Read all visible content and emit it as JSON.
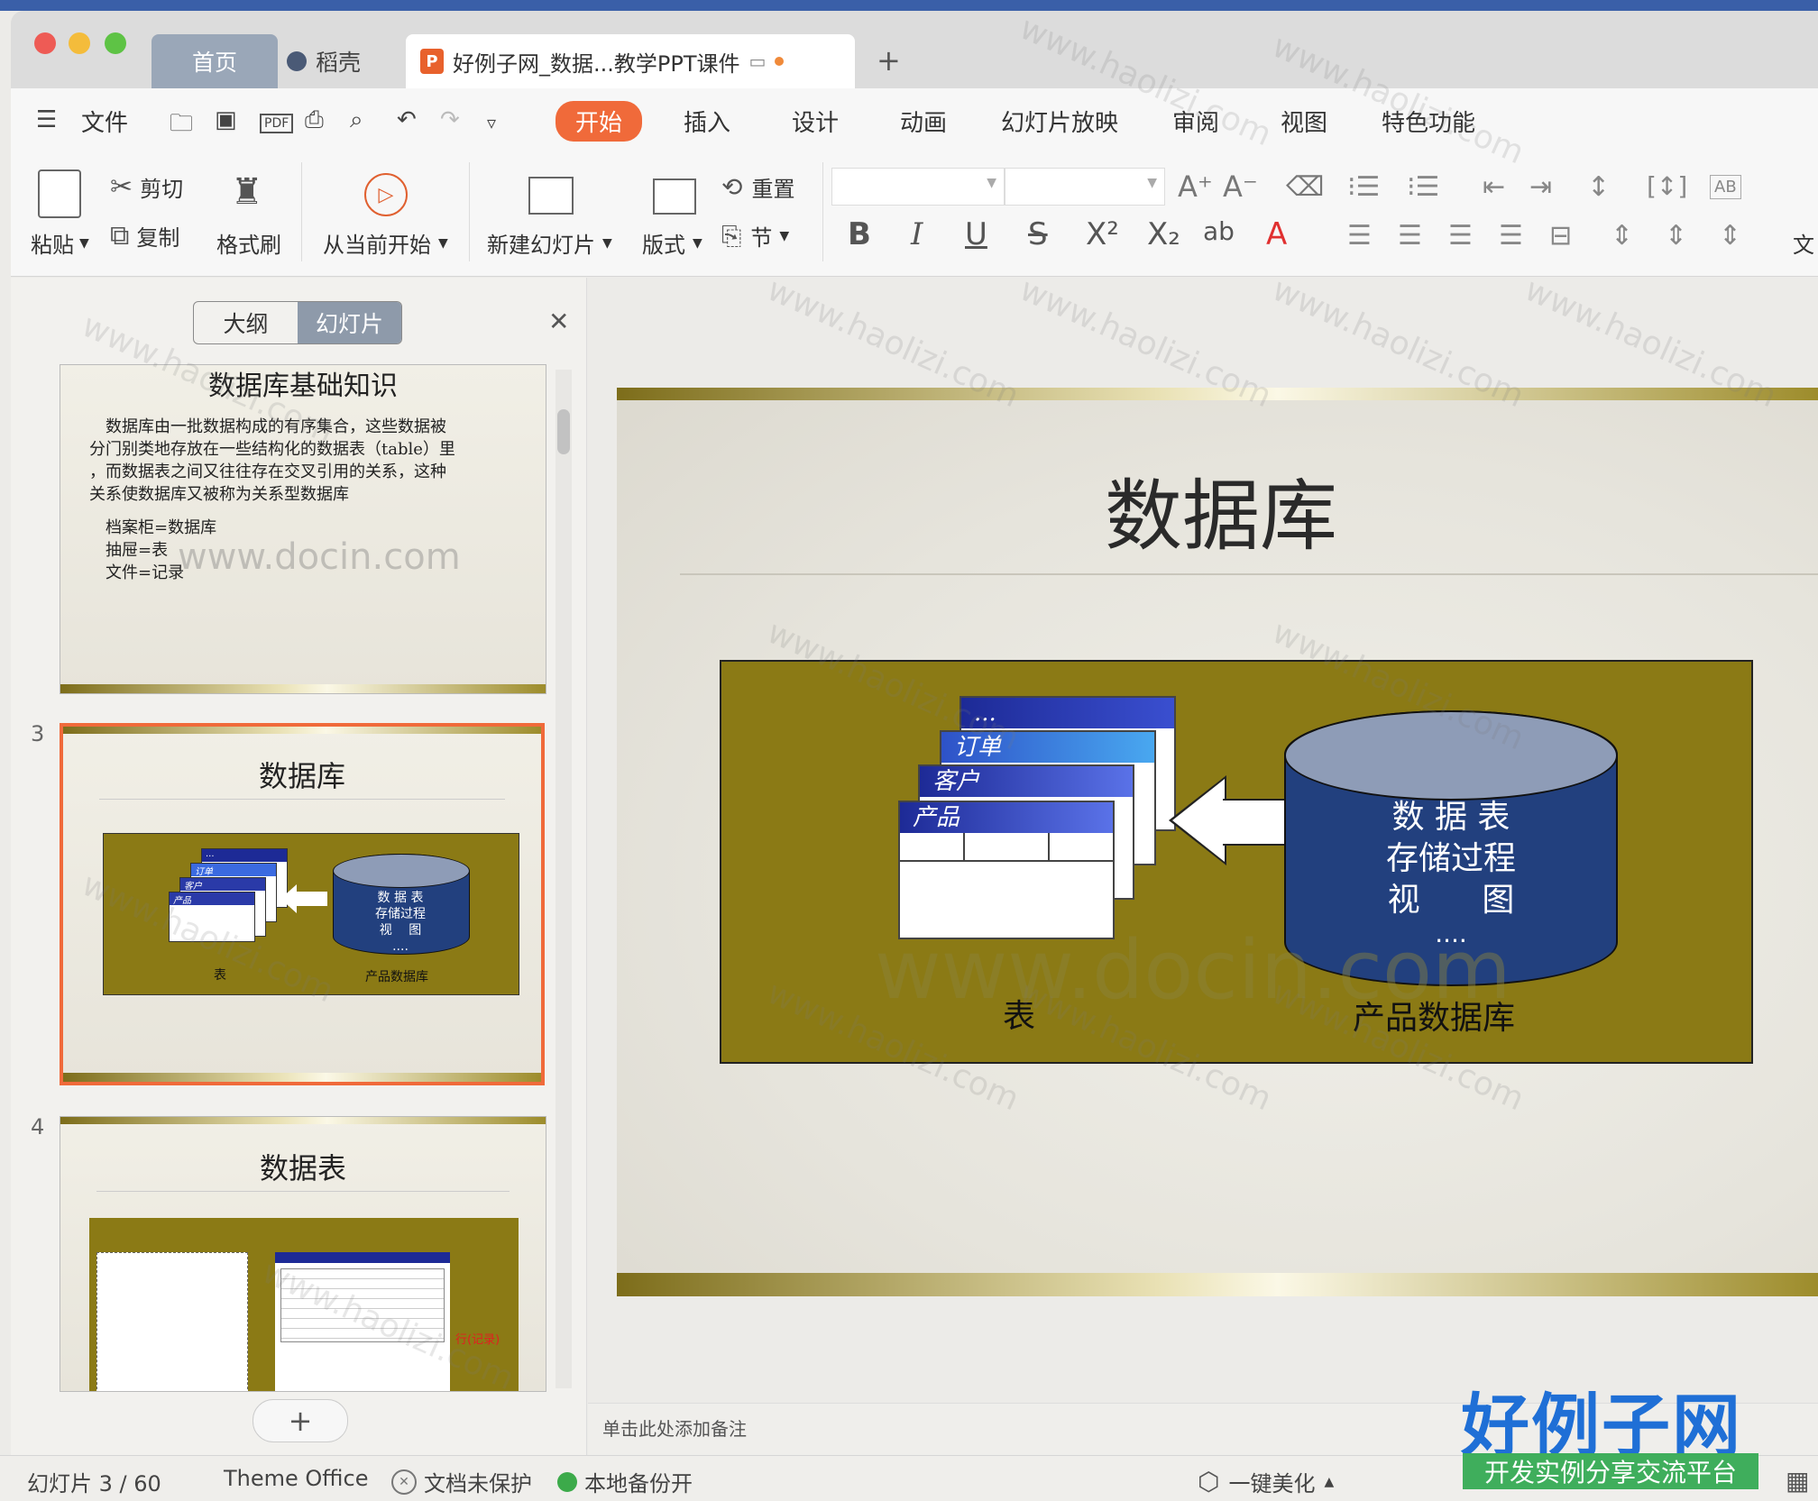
{
  "tabs": {
    "home": "首页",
    "daoke": "稻壳",
    "doc_title": "好例子网_数据...教学PPT课件"
  },
  "menu": {
    "file": "文件",
    "tabs": [
      "开始",
      "插入",
      "设计",
      "动画",
      "幻灯片放映",
      "审阅",
      "视图",
      "特色功能"
    ]
  },
  "ribbon": {
    "paste": "粘贴",
    "cut": "剪切",
    "copy": "复制",
    "format_painter": "格式刷",
    "play_from_current": "从当前开始",
    "new_slide": "新建幻灯片",
    "layout": "版式",
    "reset": "重置",
    "section": "节",
    "text_cut": "文"
  },
  "panel": {
    "outline": "大纲",
    "slides": "幻灯片"
  },
  "thumbs": {
    "s2_title": "数据库基础知识",
    "s2_body": [
      "数据库由一批数据构成的有序集合，这些数据被",
      "分门别类地存放在一些结构化的数据表（table）里",
      "，而数据表之间又往往存在交叉引用的关系，这种",
      "关系使数据库又被称为关系型数据库"
    ],
    "s2_lines": [
      "档案柜=数据库",
      "抽屉=表",
      "文件=记录"
    ],
    "s2_watermark": "www.docin.com",
    "s3_num": "3",
    "s3_title": "数据库",
    "s3_table": "表",
    "s3_db": "产品数据库",
    "s4_num": "4",
    "s4_title": "数据表",
    "s4_row_label": "行(记录)"
  },
  "slide": {
    "title": "数据库",
    "windows": [
      "...",
      "订单",
      "客户",
      "产品"
    ],
    "db_lines": [
      "数 据 表",
      "存储过程",
      "视      图",
      "...."
    ],
    "table_caption": "表",
    "db_caption": "产品数据库",
    "watermark": "www.docin.com"
  },
  "notes_placeholder": "单击此处添加备注",
  "status": {
    "slide_info": "幻灯片 3 / 60",
    "theme": "Theme Office",
    "protect": "文档未保护",
    "backup": "本地备份开",
    "beautify": "一键美化"
  },
  "brand": {
    "logo": "好例子网",
    "tagline": "开发实例分享交流平台",
    "site_watermark": "www.haolizi.com"
  },
  "colors": {
    "accent": "#f06a3a",
    "olive": "#8b7a15",
    "db_blue": "#22407e"
  }
}
